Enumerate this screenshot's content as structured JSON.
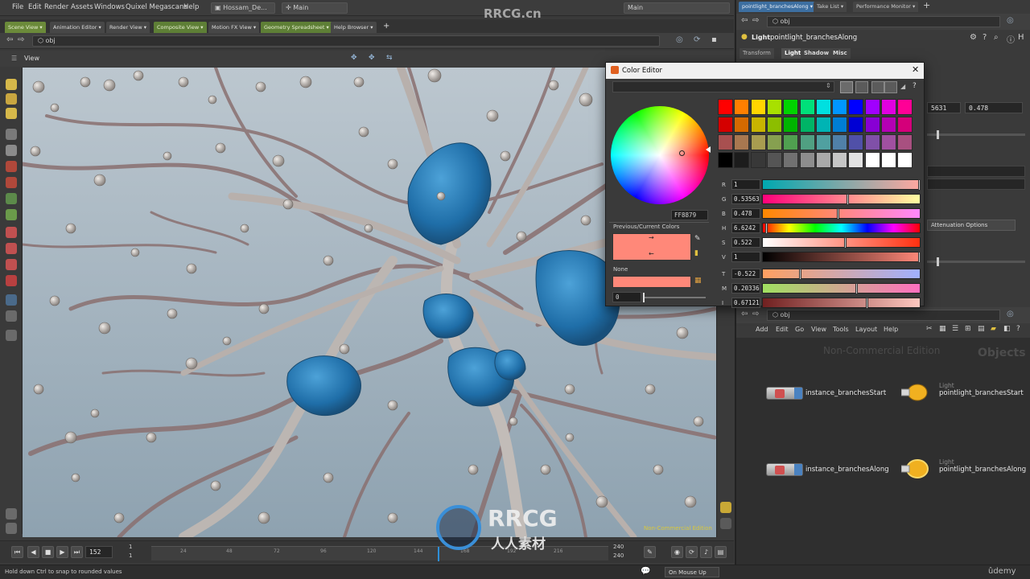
{
  "menu": [
    "File",
    "Edit",
    "Render",
    "Assets",
    "Windows",
    "Quixel Megascans",
    "Help"
  ],
  "desktop": {
    "name": "Hossam_De...",
    "network": "Main",
    "right_desktop": "Main"
  },
  "left_tabs": [
    "Scene View",
    "Animation Editor",
    "Render View",
    "Composite View",
    "Motion FX View",
    "Geometry Spreadsheet",
    "Help Browser"
  ],
  "left_path": "obj",
  "view_label": "View",
  "viewport_watermark_sub": "Non-Commercial Edition",
  "playbar": {
    "frame": "152",
    "start1": "1",
    "start2": "1",
    "ruler": [
      "24",
      "48",
      "72",
      "96",
      "120",
      "144",
      "168",
      "192",
      "216"
    ],
    "end1": "240",
    "end2": "240"
  },
  "status": {
    "hint": "Hold down Ctrl to snap to rounded values",
    "mouse_mode": "On Mouse Up",
    "udemy": "ûdemy"
  },
  "watermark": {
    "brand": "RRCG",
    "domain": "RRCG.cn",
    "cn": "人人素材"
  },
  "right_panel": {
    "tabs": [
      "pointlight_branchesAlong",
      "Take List",
      "Performance Monitor"
    ],
    "path": "obj",
    "node_type": "Light",
    "node_name": "pointlight_branchesAlong",
    "param_tabs": [
      "Transform",
      "Light",
      "Shadow",
      "Misc"
    ],
    "field1": "5631",
    "field2": "0.478",
    "attenuation_button": "Attenuation Options"
  },
  "network": {
    "path": "obj",
    "menu": [
      "Add",
      "Edit",
      "Go",
      "View",
      "Tools",
      "Layout",
      "Help"
    ],
    "edition": "Non-Commercial Edition",
    "context": "Objects",
    "nodes": [
      {
        "label": "instance_branchesStart"
      },
      {
        "label": "pointlight_branchesStart",
        "type": "Light"
      },
      {
        "label": "instance_branchesAlong"
      },
      {
        "label": "pointlight_branchesAlong",
        "type": "Light"
      }
    ]
  },
  "color_editor": {
    "title": "Color Editor",
    "hex": "FF8879",
    "prev_current_label": "Previous/Current Colors",
    "none_label": "None",
    "none_value": "0",
    "sliders": [
      {
        "label": "R",
        "value": "1"
      },
      {
        "label": "G",
        "value": "0.53563"
      },
      {
        "label": "B",
        "value": "0.478"
      },
      {
        "label": "H",
        "value": "6.6242"
      },
      {
        "label": "S",
        "value": "0.522"
      },
      {
        "label": "V",
        "value": "1"
      },
      {
        "label": "T",
        "value": "-0.522"
      },
      {
        "label": "M",
        "value": "0.20336"
      },
      {
        "label": "I",
        "value": "0.67121"
      }
    ],
    "current_color": "#ff8879",
    "palette": [
      "#ff0000",
      "#ff7f00",
      "#ffd500",
      "#a8e000",
      "#00d400",
      "#00e07a",
      "#00e0e0",
      "#0096ff",
      "#0000ff",
      "#a000ff",
      "#e000e0",
      "#ff0096",
      "#d40000",
      "#d46a00",
      "#c8b400",
      "#8cbe00",
      "#00b400",
      "#00b466",
      "#00b4b4",
      "#007ed4",
      "#0000d4",
      "#8800d4",
      "#b400b4",
      "#d4007a",
      "#a85050",
      "#a87850",
      "#a89c50",
      "#86a050",
      "#50a050",
      "#50a082",
      "#50a0a0",
      "#5080a8",
      "#5050a8",
      "#8050a8",
      "#a050a0",
      "#a85080",
      "#000000",
      "#1c1c1c",
      "#383838",
      "#555555",
      "#717171",
      "#8d8d8d",
      "#aaaaaa",
      "#c6c6c6",
      "#e2e2e2",
      "#ffffff",
      "#ffffff",
      "#ffffff"
    ]
  }
}
